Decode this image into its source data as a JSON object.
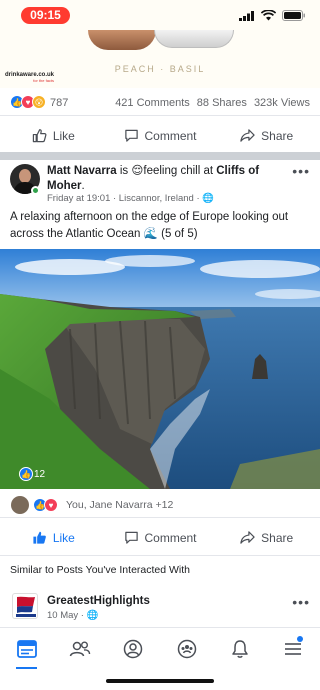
{
  "status": {
    "time": "09:15"
  },
  "ad": {
    "subtitle": "PEACH · BASIL",
    "logo": "drinkaware.co.uk",
    "logo_tag": "for the facts"
  },
  "prev_post": {
    "reaction_count": "787",
    "comments": "421 Comments",
    "shares": "88 Shares",
    "views": "323k Views",
    "actions": {
      "like": "Like",
      "comment": "Comment",
      "share": "Share"
    }
  },
  "post": {
    "author": "Matt Navarra",
    "is_text": " is ",
    "feeling_text": "feeling chill at ",
    "place": "Cliffs of Moher",
    "place_suffix": ".",
    "meta": "Friday at 19:01 · Liscannor, Ireland · ",
    "body": "A relaxing afternoon on the edge of Europe looking out across the Atlantic Ocean 🌊 (5 of 5)",
    "photo_likes": "12",
    "reacted_by": "You, Jane Navarra +12",
    "actions": {
      "like": "Like",
      "comment": "Comment",
      "share": "Share"
    }
  },
  "similar": {
    "heading": "Similar to Posts You've Interacted With",
    "page_name": "GreatestHighlights",
    "meta": "10 May · "
  },
  "colors": {
    "accent": "#1877f2",
    "time_pill": "#ff3b30"
  }
}
